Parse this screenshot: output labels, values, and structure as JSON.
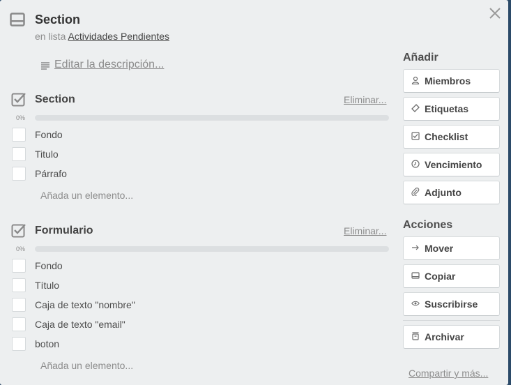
{
  "header": {
    "title": "Section",
    "list_prefix": "en lista",
    "list_name": "Actividades Pendientes",
    "edit_description": "Editar la descripción..."
  },
  "checklists": [
    {
      "title": "Section",
      "delete_label": "Eliminar...",
      "progress_label": "0%",
      "progress": 0,
      "items": [
        "Fondo",
        "Titulo",
        "Párrafo"
      ],
      "add_item": "Añada un elemento..."
    },
    {
      "title": "Formulario",
      "delete_label": "Eliminar...",
      "progress_label": "0%",
      "progress": 0,
      "items": [
        "Fondo",
        "Título",
        "Caja de texto \"nombre\"",
        "Caja de texto \"email\"",
        "boton"
      ],
      "add_item": "Añada un elemento..."
    }
  ],
  "sidebar": {
    "add_heading": "Añadir",
    "add_buttons": [
      {
        "label": "Miembros",
        "icon": "person-icon"
      },
      {
        "label": "Etiquetas",
        "icon": "tag-icon"
      },
      {
        "label": "Checklist",
        "icon": "checkbox-icon"
      },
      {
        "label": "Vencimiento",
        "icon": "clock-icon"
      },
      {
        "label": "Adjunto",
        "icon": "paperclip-icon"
      }
    ],
    "actions_heading": "Acciones",
    "action_buttons": [
      {
        "label": "Mover",
        "icon": "arrow-right-icon"
      },
      {
        "label": "Copiar",
        "icon": "card-icon"
      },
      {
        "label": "Suscribirse",
        "icon": "eye-icon"
      }
    ],
    "archive_button": {
      "label": "Archivar",
      "icon": "archive-icon"
    },
    "share_link": "Compartir y más..."
  }
}
